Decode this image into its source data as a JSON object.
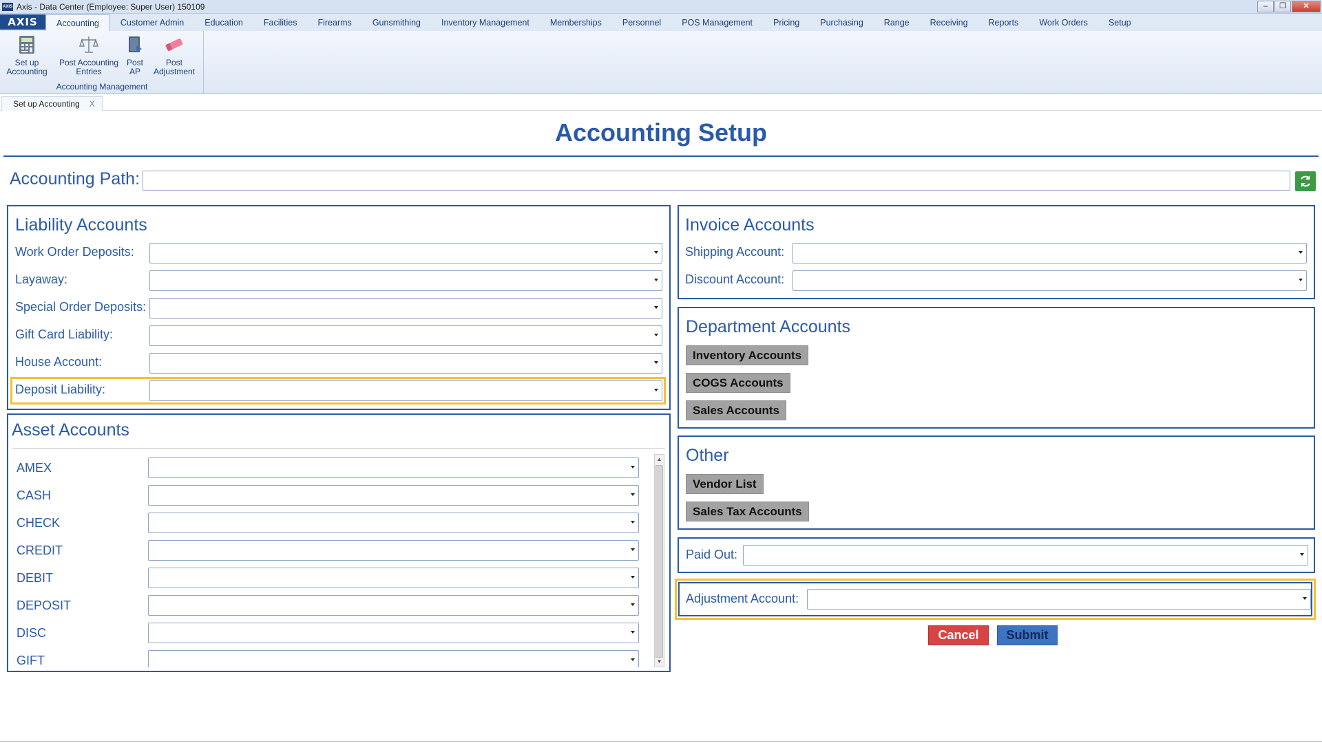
{
  "window": {
    "title": "Axis - Data Center  (Employee: Super User) 150109",
    "icon_text": "AXIS",
    "controls": [
      "–",
      "❐",
      "✕"
    ]
  },
  "logo": "AXIS",
  "menu": {
    "tabs": [
      "Accounting",
      "Customer Admin",
      "Education",
      "Facilities",
      "Firearms",
      "Gunsmithing",
      "Inventory Management",
      "Memberships",
      "Personnel",
      "POS Management",
      "Pricing",
      "Purchasing",
      "Range",
      "Receiving",
      "Reports",
      "Work Orders",
      "Setup"
    ],
    "active": "Accounting"
  },
  "ribbon": {
    "group_label": "Accounting Management",
    "buttons": [
      {
        "line1": "Set up",
        "line2": "Accounting",
        "icon": "calculator-icon"
      },
      {
        "line1": "Post Accounting",
        "line2": "Entries",
        "icon": "scales-icon"
      },
      {
        "line1": "Post",
        "line2": "AP",
        "icon": "book-icon"
      },
      {
        "line1": "Post",
        "line2": "Adjustment",
        "icon": "eraser-icon"
      }
    ]
  },
  "doc_tab": {
    "label": "Set up Accounting",
    "close": "X"
  },
  "page_title": "Accounting Setup",
  "accounting_path": {
    "label": "Accounting Path:",
    "value": "",
    "refresh_icon": "refresh-icon"
  },
  "liability": {
    "title": "Liability Accounts",
    "fields": [
      {
        "label": "Work Order Deposits:",
        "value": ""
      },
      {
        "label": "Layaway:",
        "value": ""
      },
      {
        "label": "Special Order Deposits:",
        "value": ""
      },
      {
        "label": "Gift Card Liability:",
        "value": ""
      },
      {
        "label": "House Account:",
        "value": ""
      },
      {
        "label": "Deposit Liability:",
        "value": ""
      }
    ]
  },
  "asset": {
    "title": "Asset Accounts",
    "rows": [
      {
        "label": "AMEX",
        "value": ""
      },
      {
        "label": "CASH",
        "value": ""
      },
      {
        "label": "CHECK",
        "value": ""
      },
      {
        "label": "CREDIT",
        "value": ""
      },
      {
        "label": "DEBIT",
        "value": ""
      },
      {
        "label": "DEPOSIT",
        "value": ""
      },
      {
        "label": "DISC",
        "value": ""
      },
      {
        "label": "GIFT",
        "value": ""
      }
    ]
  },
  "invoice": {
    "title": "Invoice Accounts",
    "fields": [
      {
        "label": "Shipping Account:",
        "value": ""
      },
      {
        "label": "Discount Account:",
        "value": ""
      }
    ]
  },
  "department": {
    "title": "Department Accounts",
    "buttons": [
      "Inventory Accounts",
      "COGS Accounts",
      "Sales Accounts"
    ]
  },
  "other": {
    "title": "Other",
    "buttons": [
      "Vendor List",
      "Sales Tax Accounts"
    ]
  },
  "paid_out": {
    "label": "Paid Out:",
    "value": ""
  },
  "adjustment": {
    "label": "Adjustment Account:",
    "value": ""
  },
  "actions": {
    "cancel": "Cancel",
    "submit": "Submit"
  },
  "colors": {
    "accent": "#2a5aa8",
    "highlight": "#f5c034",
    "cancel": "#d84343",
    "submit": "#3f72c2",
    "refresh": "#3c9a45"
  }
}
